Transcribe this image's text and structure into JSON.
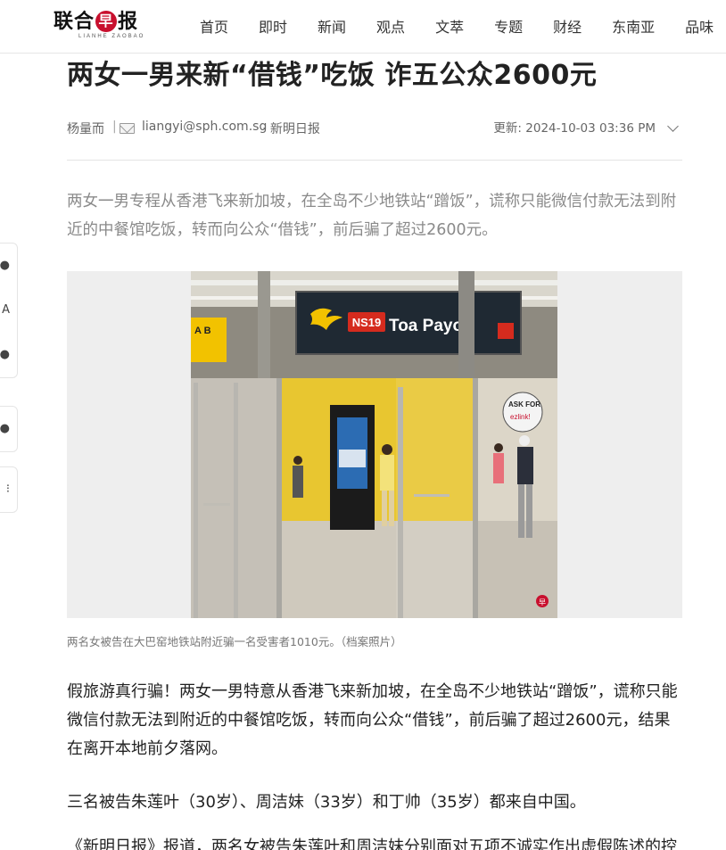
{
  "header": {
    "logo_text_a": "联合",
    "logo_text_zao": "早",
    "logo_text_b": "报",
    "logo_sub": "LIANHE ZAOBAO",
    "nav": [
      "首页",
      "即时",
      "新闻",
      "观点",
      "文萃",
      "专题",
      "财经",
      "东南亚",
      "品味"
    ]
  },
  "article": {
    "headline": "两女一男来新“借钱”吃饭 诈五公众2600元",
    "author": "杨量而",
    "separator": "|",
    "email": "liangyi@sph.com.sg",
    "source": "· 新明日报",
    "updated": "更新: 2024-10-03 03:36 PM",
    "summary": "两女一男专程从香港飞来新加坡，在全岛不少地铁站“蹭饭”，谎称只能微信付款无法到附近的中餐馆吃饭，转而向公众“借钱”，前后骗了超过2600元。",
    "photo": {
      "station_code": "NS19",
      "station_name": "Toa Payoh",
      "sign_ab": "A B",
      "ask_for": "ASK FOR",
      "ask_for_sub": "ezlink!",
      "watermark": "早"
    },
    "caption": "两名女被告在大巴窑地铁站附近骗一名受害者1010元。（档案照片）",
    "paragraphs": [
      "假旅游真行骗！两女一男特意从香港飞来新加坡，在全岛不少地铁站“蹭饭”，谎称只能微信付款无法到附近的中餐馆吃饭，转而向公众“借钱”，前后骗了超过2600元，结果在离开本地前夕落网。",
      "三名被告朱莲叶（30岁）、周洁妹（33岁）和丁帅（35岁）都来自中国。",
      "《新明日报》报道，两名女被告朱莲叶和周洁妹分别面对五项不诚实作出虚假陈述的控"
    ]
  },
  "colors": {
    "accent": "#c8102e",
    "summary_text": "#8a8a8a",
    "station_sign": "#1f2933"
  }
}
